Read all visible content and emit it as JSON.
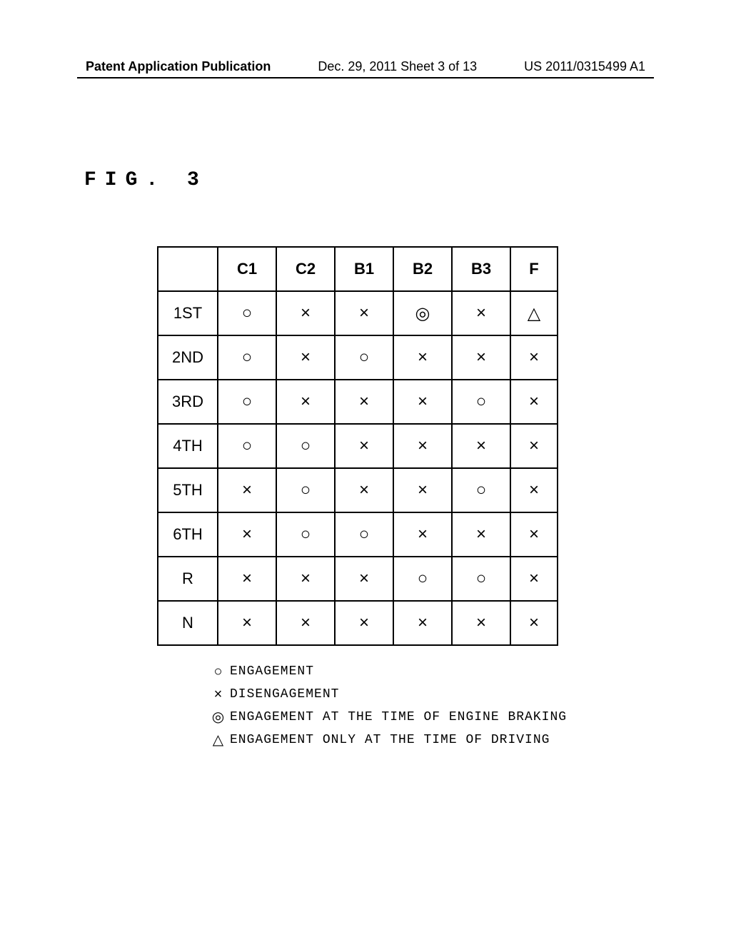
{
  "header": {
    "left": "Patent Application Publication",
    "center": "Dec. 29, 2011  Sheet 3 of 13",
    "right": "US 2011/0315499 A1"
  },
  "figure_label": "FIG. 3",
  "table": {
    "columns": [
      "",
      "C1",
      "C2",
      "B1",
      "B2",
      "B3",
      "F"
    ],
    "rows": [
      {
        "label": "1ST",
        "cells": [
          "○",
          "×",
          "×",
          "◎",
          "×",
          "△"
        ]
      },
      {
        "label": "2ND",
        "cells": [
          "○",
          "×",
          "○",
          "×",
          "×",
          "×"
        ]
      },
      {
        "label": "3RD",
        "cells": [
          "○",
          "×",
          "×",
          "×",
          "○",
          "×"
        ]
      },
      {
        "label": "4TH",
        "cells": [
          "○",
          "○",
          "×",
          "×",
          "×",
          "×"
        ]
      },
      {
        "label": "5TH",
        "cells": [
          "×",
          "○",
          "×",
          "×",
          "○",
          "×"
        ]
      },
      {
        "label": "6TH",
        "cells": [
          "×",
          "○",
          "○",
          "×",
          "×",
          "×"
        ]
      },
      {
        "label": "R",
        "cells": [
          "×",
          "×",
          "×",
          "○",
          "○",
          "×"
        ]
      },
      {
        "label": "N",
        "cells": [
          "×",
          "×",
          "×",
          "×",
          "×",
          "×"
        ]
      }
    ]
  },
  "legend": {
    "items": [
      {
        "symbol": "○",
        "text": "ENGAGEMENT"
      },
      {
        "symbol": "×",
        "text": "DISENGAGEMENT"
      },
      {
        "symbol": "◎",
        "text": "ENGAGEMENT AT THE TIME OF ENGINE BRAKING"
      },
      {
        "symbol": "△",
        "text": "ENGAGEMENT ONLY AT THE TIME OF DRIVING"
      }
    ]
  }
}
